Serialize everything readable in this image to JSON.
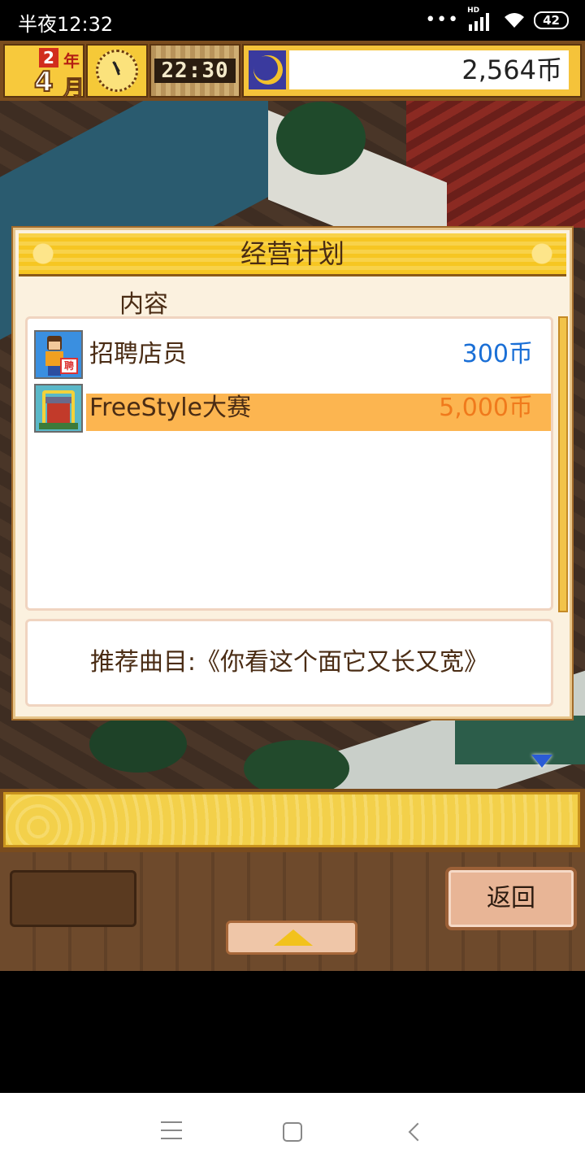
{
  "status_bar": {
    "time": "半夜12:32",
    "network_label": "HD",
    "battery": "42"
  },
  "hud": {
    "year": "2",
    "year_unit": "年",
    "month": "4",
    "month_unit": "月",
    "clock": "22:30",
    "money": "2,564币"
  },
  "dialog": {
    "title": "经营计划",
    "column_label": "内容",
    "items": [
      {
        "label": "招聘店员",
        "price": "300币",
        "price_color": "#1a6fd6",
        "icon": "hire-staff-icon",
        "selected": false
      },
      {
        "label": "FreeStyle大赛",
        "price": "5,000币",
        "price_color": "#f07a1c",
        "icon": "festival-stage-icon",
        "selected": true
      }
    ],
    "description": "推荐曲目:《你看这个面它又长又宽》"
  },
  "toolbar": {
    "back_label": "返回"
  },
  "colors": {
    "hud_frame": "#7a4c1e",
    "gold": "#f6c622",
    "selection": "#fcb550"
  }
}
